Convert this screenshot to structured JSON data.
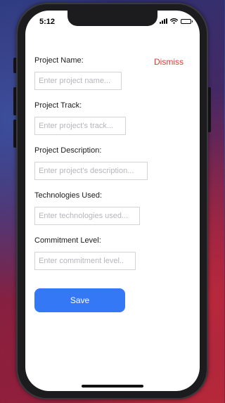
{
  "status_bar": {
    "time": "5:12"
  },
  "header": {
    "dismiss_label": "Dismiss"
  },
  "form": {
    "fields": [
      {
        "label": "Project Name:",
        "placeholder": "Enter project name...",
        "value": ""
      },
      {
        "label": "Project Track:",
        "placeholder": "Enter project's track...",
        "value": ""
      },
      {
        "label": "Project Description:",
        "placeholder": "Enter project's description...",
        "value": ""
      },
      {
        "label": "Technologies Used:",
        "placeholder": "Enter technologies used...",
        "value": ""
      },
      {
        "label": "Commitment Level:",
        "placeholder": "Enter commitment level..",
        "value": ""
      }
    ],
    "save_label": "Save"
  },
  "colors": {
    "accent": "#3478f6",
    "dismiss": "#e03a2f"
  },
  "icons": [
    "wifi-icon",
    "battery-icon",
    "signal-icon"
  ]
}
